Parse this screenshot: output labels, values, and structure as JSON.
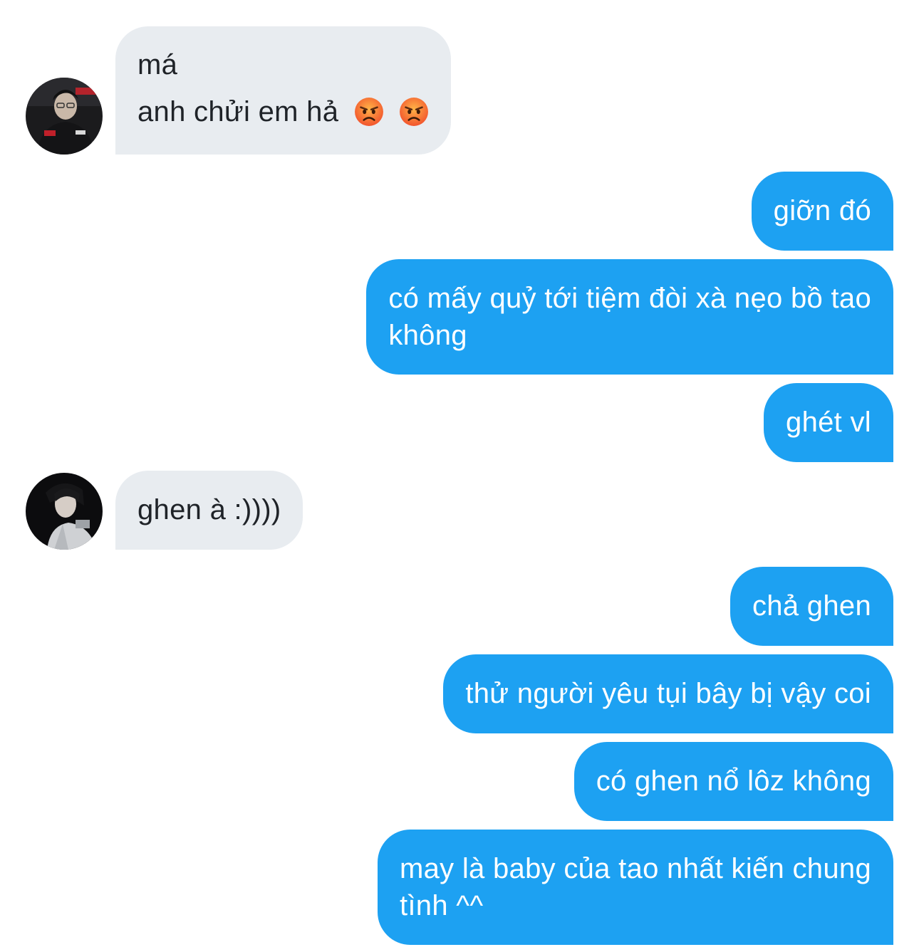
{
  "messages": [
    {
      "from": "them",
      "lines": [
        "má",
        "anh chửi em hả"
      ],
      "emojis": [
        "angry-face",
        "angry-face"
      ]
    },
    {
      "from": "me",
      "lines": [
        "giỡn đó"
      ]
    },
    {
      "from": "me",
      "lines": [
        "có mấy quỷ tới tiệm đòi xà nẹo bồ tao",
        "không"
      ]
    },
    {
      "from": "me",
      "lines": [
        "ghét vl"
      ]
    },
    {
      "from": "them",
      "lines": [
        "ghen à :))))"
      ]
    },
    {
      "from": "me",
      "lines": [
        "chả ghen"
      ]
    },
    {
      "from": "me",
      "lines": [
        "thử người yêu tụi bây bị vậy coi"
      ]
    },
    {
      "from": "me",
      "lines": [
        "có ghen nổ lôz không"
      ]
    },
    {
      "from": "me",
      "lines": [
        "may là baby của tao nhất kiến chung",
        "tình ^^"
      ]
    }
  ],
  "colors": {
    "outgoing_bubble": "#1da1f2",
    "incoming_bubble": "#e8ecf0",
    "incoming_text": "#1f2328",
    "outgoing_text": "#ffffff",
    "background": "#ffffff"
  },
  "icons": {
    "avatar_1": "avatar-photo",
    "avatar_2": "avatar-photo",
    "emoji": "angry-face"
  }
}
